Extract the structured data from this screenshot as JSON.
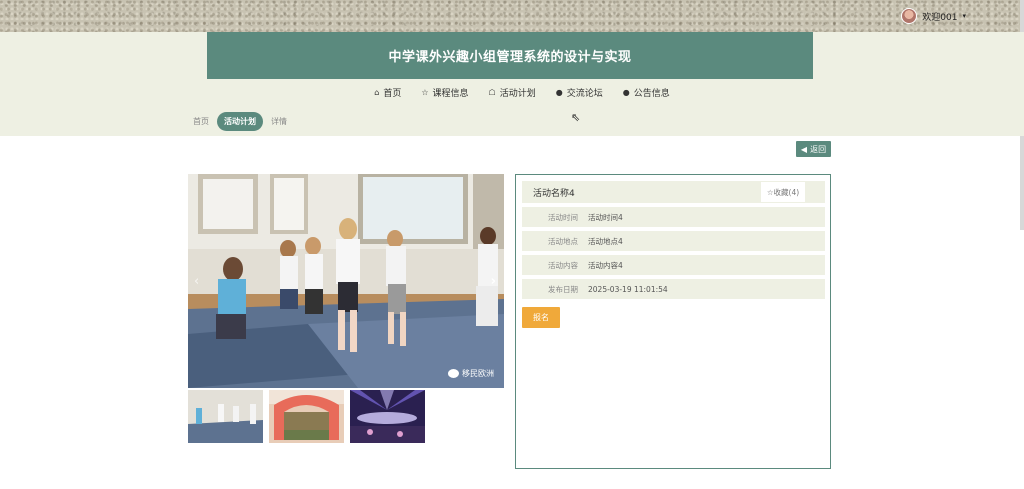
{
  "user": {
    "greeting": "欢迎001",
    "caret": "▾"
  },
  "header": {
    "title": "中学课外兴趣小组管理系统的设计与实现"
  },
  "nav": [
    {
      "icon": "⌂",
      "label": "首页"
    },
    {
      "icon": "☆",
      "label": "课程信息"
    },
    {
      "icon": "☖",
      "label": "活动计划"
    },
    {
      "icon": "●",
      "label": "交流论坛"
    },
    {
      "icon": "●",
      "label": "公告信息"
    }
  ],
  "breadcrumb": {
    "home": "首页",
    "current": "活动计划",
    "detail": "详情"
  },
  "back": {
    "icon": "◀",
    "label": "返回"
  },
  "activity": {
    "name": "活动名称4",
    "favorite": "☆收藏(4)",
    "fields": [
      {
        "label": "活动时间",
        "value": "活动时间4"
      },
      {
        "label": "活动地点",
        "value": "活动地点4"
      },
      {
        "label": "活动内容",
        "value": "活动内容4"
      },
      {
        "label": "发布日期",
        "value": "2025-03-19 11:01:54"
      }
    ],
    "signup": "报名"
  },
  "carousel": {
    "watermark": "移民欧洲",
    "prev": "‹",
    "next": "›"
  },
  "colors": {
    "accent": "#5b8a7e",
    "band": "#eef0e3",
    "signup": "#f0a93a"
  }
}
